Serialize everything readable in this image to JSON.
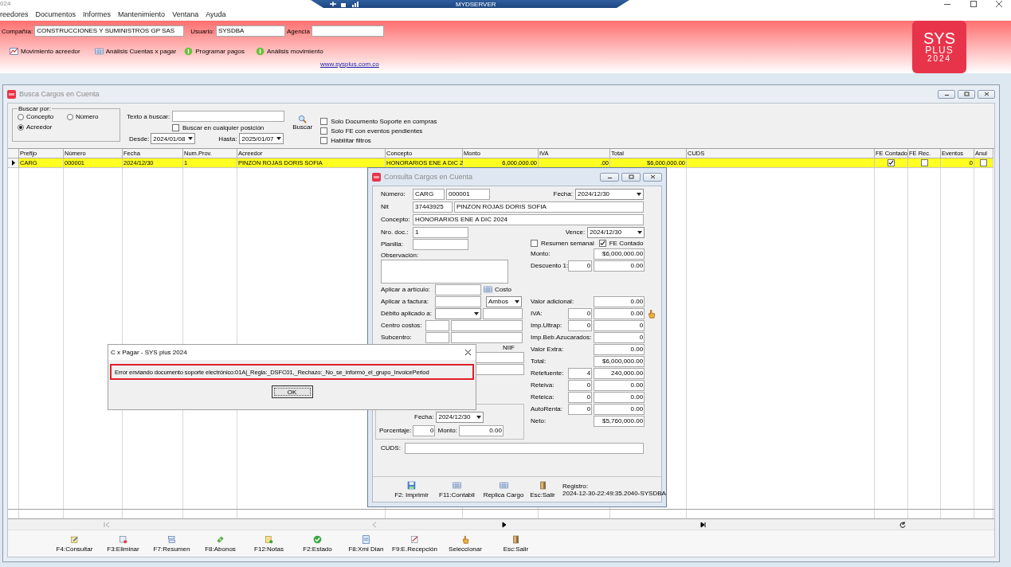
{
  "app": {
    "title": "024",
    "server": "MYDSERVER"
  },
  "menu": [
    "reedores",
    "Documentos",
    "Informes",
    "Mantenimiento",
    "Ventana",
    "Ayuda"
  ],
  "header": {
    "fields": [
      {
        "label": "Compañía:",
        "value": "CONSTRUCCIONES Y SUMINISTROS GP SAS"
      },
      {
        "label": "Usuario:",
        "value": "SYSDBA"
      },
      {
        "label": "Agencia"
      }
    ],
    "toolbar": [
      {
        "label": "Movimiento acreedor",
        "kind": "chart"
      },
      {
        "label": "Análisis Cuentas x pagar",
        "kind": "grid"
      },
      {
        "label": "Programar pagos",
        "kind": "coin"
      },
      {
        "label": "Análisis movimiento",
        "kind": "coin"
      }
    ],
    "link": "www.sysplus.com.co",
    "logo": [
      "SYS",
      "PLUS",
      "2024"
    ]
  },
  "search": {
    "title": "Busca Cargos en Cuenta",
    "buscar_por": {
      "legend": "Buscar por:",
      "options": [
        {
          "label": "Concepto",
          "selected": false
        },
        {
          "label": "Número",
          "selected": false
        },
        {
          "label": "Acreedor",
          "selected": true
        }
      ]
    },
    "texto": {
      "label": "Texto a buscar:"
    },
    "cualquier": {
      "label": "Buscar en cualquier posición",
      "checked": false
    },
    "desde": {
      "label": "Desde:",
      "value": "2024/01/08"
    },
    "hasta": {
      "label": "Hasta:",
      "value": "2025/01/07"
    },
    "buscar": "Buscar",
    "filters": [
      {
        "label": "Solo Documento Soporte en compras",
        "checked": false
      },
      {
        "label": "Solo FE con eventos pendientes",
        "checked": false
      },
      {
        "label": "Habilitar filtros",
        "checked": false
      }
    ],
    "columns": [
      {
        "label": "Prefijo",
        "kind": "text"
      },
      {
        "label": "Número",
        "kind": "text"
      },
      {
        "label": "Fecha",
        "kind": "text"
      },
      {
        "label": "Num.Prov.",
        "kind": "text"
      },
      {
        "label": "Acreedor",
        "kind": "text"
      },
      {
        "label": "Concepto",
        "kind": "text"
      },
      {
        "label": "Monto",
        "kind": "number"
      },
      {
        "label": "IVA",
        "kind": "number"
      },
      {
        "label": "Total",
        "kind": "number"
      },
      {
        "label": "CUDS",
        "kind": "blank"
      },
      {
        "label": "FE Contado",
        "kind": "check"
      },
      {
        "label": "FE Rec.",
        "kind": "check"
      },
      {
        "label": "Eventos",
        "kind": "number"
      },
      {
        "label": "Anul",
        "kind": "check"
      }
    ],
    "rows": [
      {
        "selected": true,
        "values": [
          "CARG",
          "000001",
          "2024/12/30",
          "1",
          "PINZON ROJAS DORIS SOFIA",
          "HONORARIOS ENE A DIC 2",
          "6,000,000.00",
          ".00",
          "$6,000,000.00",
          true,
          false,
          "0",
          false
        ]
      }
    ],
    "actions": [
      {
        "label": "F4:Consultar",
        "kind": "pencil"
      },
      {
        "label": "F3:Eliminar",
        "kind": "trash"
      },
      {
        "label": "F7:Resumen",
        "kind": "stack"
      },
      {
        "label": "F8:Abonos",
        "kind": "money"
      },
      {
        "label": "F12:Notas",
        "kind": "note"
      },
      {
        "label": "F2:Estado",
        "kind": "check"
      },
      {
        "label": "F8:Xml Dian",
        "kind": "document"
      },
      {
        "label": "F9:E.Recepción",
        "kind": "sign"
      },
      {
        "label": "Seleccionar",
        "kind": "hand"
      },
      {
        "label": "Esc:Salir",
        "kind": "door"
      }
    ]
  },
  "consulta": {
    "title": "Consulta Cargos en Cuenta",
    "numero": {
      "label": "Número:",
      "prefix": "CARG",
      "value": "000001"
    },
    "fecha": {
      "label": "Fecha:",
      "value": "2024/12/30"
    },
    "nit": {
      "label": "Nit",
      "value": "37443925",
      "name": "PINZON ROJAS DORIS SOFIA"
    },
    "concepto": {
      "label": "Concepto:",
      "value": "HONORARIOS ENE A DIC 2024"
    },
    "nro_doc": {
      "label": "Nro. doc.:",
      "value": "1"
    },
    "planilla": {
      "label": "Planilla:"
    },
    "observacion": {
      "label": "Observación:"
    },
    "articulo": {
      "label": "Aplicar a artículo:",
      "costo": "Costo"
    },
    "factura": {
      "label": "Aplicar a factura:",
      "tipo": "Ambos"
    },
    "debito": {
      "label": "Débito aplicado a:"
    },
    "centro": {
      "label": "Centro costos:"
    },
    "subcentro": {
      "label": "Subcentro:"
    },
    "niif": "NIIF",
    "pago": {
      "fecha_label": "Fecha:",
      "fecha": "2024/12/30",
      "porcentaje_label": "Porcentaje:",
      "porcentaje": "0",
      "monto_label": "Monto:",
      "monto": "0.00"
    },
    "vence": {
      "label": "Vence:",
      "value": "2024/12/30"
    },
    "options": [
      {
        "label": "Resumen semanal",
        "checked": false
      },
      {
        "label": "FE Contado",
        "checked": true
      }
    ],
    "amounts_top": [
      {
        "label": "Monto:",
        "value": "$6,000,000.00"
      },
      {
        "label": "Descuento 1:",
        "rate": "0",
        "value": "0.00"
      }
    ],
    "amounts": [
      {
        "label": "Valor adicional:",
        "value": "0.00"
      },
      {
        "label": "IVA:",
        "rate": "0",
        "value": "0.00"
      },
      {
        "label": "Imp.Ultrap:",
        "rate": "0",
        "value": "0"
      },
      {
        "label": "Imp.Beb.Azucarados:",
        "value": "0"
      },
      {
        "label": "Valor Extra:",
        "value": "0.00"
      },
      {
        "label": "Total:",
        "value": "$6,000,000.00"
      },
      {
        "label": "Retefuente:",
        "rate": "4",
        "value": "240,000.00"
      },
      {
        "label": "Reteiva:",
        "rate": "0",
        "value": "0.00"
      },
      {
        "label": "Reteica:",
        "rate": "0",
        "value": "0.00"
      },
      {
        "label": "AutoRenta:",
        "rate": "0",
        "value": "0.00"
      },
      {
        "label": "Neto:",
        "value": "$5,760,000.00"
      }
    ],
    "cuds": {
      "label": "CUDS:"
    },
    "actions": [
      {
        "label": "F2: Imprimir",
        "kind": "save"
      },
      {
        "label": "F11:Contabil",
        "kind": "grid"
      },
      {
        "label": "Replica Cargo",
        "kind": "grid"
      },
      {
        "label": "Esc:Salir",
        "kind": "door"
      }
    ],
    "registro": {
      "label": "Registro:",
      "value": "2024-12-30-22:49:35.2040-SYSDBA"
    }
  },
  "message_box": {
    "title": "C x Pagar - SYS plus 2024",
    "message": "Error enviando documento soporte electrónico:01A|_Regla:_DSFC01,_Rechazo:_No_se_informó_el_grupo_InvoicePeriod",
    "button": "OK"
  }
}
